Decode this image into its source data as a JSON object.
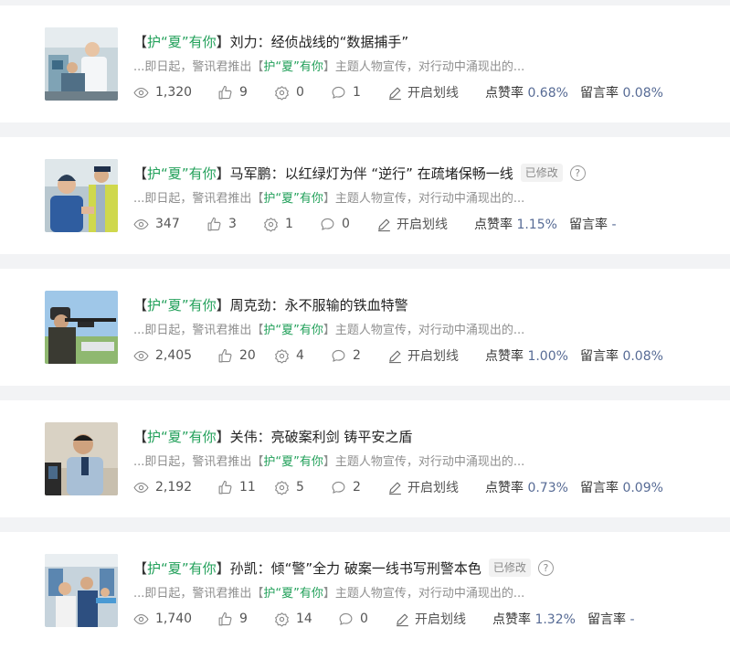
{
  "articles": [
    {
      "tag_open": "【",
      "tag_a": "护“",
      "tag_b": "夏",
      "tag_c": "”有你",
      "tag_close": "】",
      "title": "刘力：经侦战线的“数据捕手”",
      "badge": "",
      "summary_pre": "...即日起，警讯君推出",
      "summary_tag_open": "【",
      "summary_tag": "护“夏”有你",
      "summary_tag_close": "】",
      "summary_post": "主题人物宣传，对行动中涌现出的...",
      "views": "1,320",
      "likes": "9",
      "shares": "0",
      "comments": "1",
      "mark_label": "开启划线",
      "like_rate_label": "点赞率",
      "like_rate": "0.68%",
      "comment_rate_label": "留言率",
      "comment_rate": "0.08%"
    },
    {
      "tag_open": "【",
      "tag_a": "护“",
      "tag_b": "夏",
      "tag_c": "”有你",
      "tag_close": "】",
      "title": "马军鹏：以红绿灯为伴 “逆行” 在疏堵保畅一线",
      "badge": "已修改",
      "summary_pre": "...即日起，警讯君推出",
      "summary_tag_open": "【",
      "summary_tag": "护“夏”有你",
      "summary_tag_close": "】",
      "summary_post": "主题人物宣传，对行动中涌现出的...",
      "views": "347",
      "likes": "3",
      "shares": "1",
      "comments": "0",
      "mark_label": "开启划线",
      "like_rate_label": "点赞率",
      "like_rate": "1.15%",
      "comment_rate_label": "留言率",
      "comment_rate": "-"
    },
    {
      "tag_open": "【",
      "tag_a": "护“",
      "tag_b": "夏",
      "tag_c": "”有你",
      "tag_close": "】",
      "title": "周克劲：永不服输的铁血特警",
      "badge": "",
      "summary_pre": "...即日起，警讯君推出",
      "summary_tag_open": "【",
      "summary_tag": "护“夏”有你",
      "summary_tag_close": "】",
      "summary_post": "主题人物宣传，对行动中涌现出的...",
      "views": "2,405",
      "likes": "20",
      "shares": "4",
      "comments": "2",
      "mark_label": "开启划线",
      "like_rate_label": "点赞率",
      "like_rate": "1.00%",
      "comment_rate_label": "留言率",
      "comment_rate": "0.08%"
    },
    {
      "tag_open": "【",
      "tag_a": "护“",
      "tag_b": "夏",
      "tag_c": "”有你",
      "tag_close": "】",
      "title": "关伟：亮破案利剑 铸平安之盾",
      "badge": "",
      "summary_pre": "...即日起，警讯君推出",
      "summary_tag_open": "【",
      "summary_tag": "护“夏”有你",
      "summary_tag_close": "】",
      "summary_post": "主题人物宣传，对行动中涌现出的...",
      "views": "2,192",
      "likes": "11",
      "shares": "5",
      "comments": "2",
      "mark_label": "开启划线",
      "like_rate_label": "点赞率",
      "like_rate": "0.73%",
      "comment_rate_label": "留言率",
      "comment_rate": "0.09%"
    },
    {
      "tag_open": "【",
      "tag_a": "护“",
      "tag_b": "夏",
      "tag_c": "”有你",
      "tag_close": "】",
      "title": "孙凯：倾“警”全力 破案一线书写刑警本色",
      "badge": "已修改",
      "summary_pre": "...即日起，警讯君推出",
      "summary_tag_open": "【",
      "summary_tag": "护“夏”有你",
      "summary_tag_close": "】",
      "summary_post": "主题人物宣传，对行动中涌现出的...",
      "views": "1,740",
      "likes": "9",
      "shares": "14",
      "comments": "0",
      "mark_label": "开启划线",
      "like_rate_label": "点赞率",
      "like_rate": "1.32%",
      "comment_rate_label": "留言率",
      "comment_rate": "-"
    }
  ],
  "help_glyph": "?",
  "colors": {
    "accent_green": "#22a05a",
    "rate_blue": "#576b95",
    "page_bg": "#f2f3f5"
  }
}
